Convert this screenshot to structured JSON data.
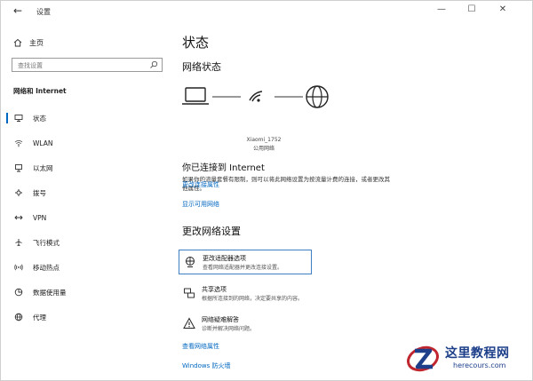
{
  "window": {
    "title": "设置",
    "back_glyph": "←",
    "minimize_glyph": "—",
    "maximize_glyph": "☐",
    "close_glyph": "✕"
  },
  "sidebar": {
    "home_label": "主页",
    "search_placeholder": "查找设置",
    "section_title": "网络和 Internet",
    "items": [
      {
        "label": "状态",
        "icon": "status-icon",
        "active": true
      },
      {
        "label": "WLAN",
        "icon": "wifi-icon"
      },
      {
        "label": "以太网",
        "icon": "ethernet-icon"
      },
      {
        "label": "拨号",
        "icon": "dialup-icon"
      },
      {
        "label": "VPN",
        "icon": "vpn-icon"
      },
      {
        "label": "飞行模式",
        "icon": "airplane-icon"
      },
      {
        "label": "移动热点",
        "icon": "hotspot-icon"
      },
      {
        "label": "数据使用量",
        "icon": "data-usage-icon"
      },
      {
        "label": "代理",
        "icon": "globe-icon"
      }
    ]
  },
  "main": {
    "title": "状态",
    "network_status_heading": "网络状态",
    "ssid": "Xiaomi_1752",
    "ssid_type": "公用网络",
    "connected_heading": "你已连接到 Internet",
    "connected_desc": "如果你的流量套餐有限制，则可以将此网络设置为按流量计费的连接，或者更改其他属性。",
    "link_change_props": "更改连接属性",
    "link_show_networks": "显示可用网络",
    "change_settings_heading": "更改网络设置",
    "options": [
      {
        "title": "更改适配器选项",
        "subtitle": "查看网络适配器并更改连接设置。",
        "icon": "adapter-icon"
      },
      {
        "title": "共享选项",
        "subtitle": "根据所连接到的网络，决定要共享的内容。",
        "icon": "sharing-icon"
      },
      {
        "title": "网络疑难解答",
        "subtitle": "诊断并解决网络问题。",
        "icon": "warning-icon"
      }
    ],
    "link_view_props": "查看网络属性",
    "link_firewall": "Windows 防火墙"
  },
  "watermark": {
    "name": "这里教程网",
    "url": "herecours.com"
  },
  "colors": {
    "accent": "#0067c0",
    "watermark": "#1d3f8a"
  }
}
